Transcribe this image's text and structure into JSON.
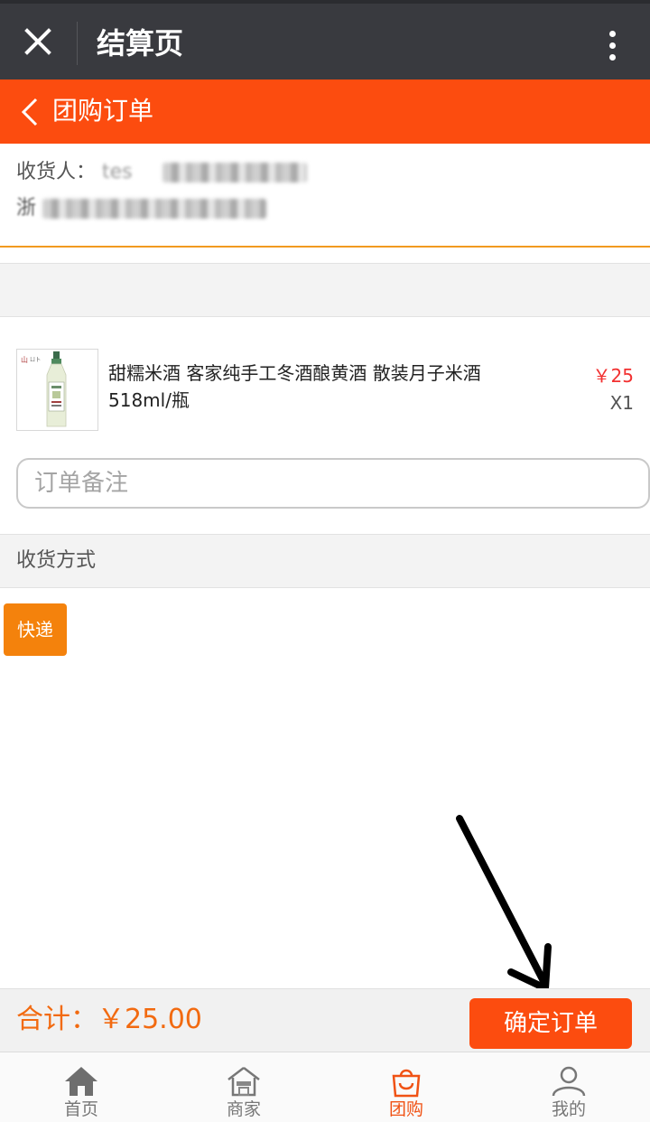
{
  "wechat_bar": {
    "title": "结算页",
    "close_icon": "close-icon",
    "more_icon": "more-vertical-icon"
  },
  "nav": {
    "title": "团购订单",
    "back_icon": "chevron-left-icon"
  },
  "address": {
    "recipient_label": "收货人：",
    "recipient_name_visible": "tes",
    "address_prefix": "浙"
  },
  "product": {
    "name": "甜糯米酒 客家纯手工冬酒酿黄酒 散装月子米酒518ml/瓶",
    "price": "￥25",
    "quantity": "X1",
    "image": "rice-wine-bottle"
  },
  "remark": {
    "placeholder": "订单备注"
  },
  "shipping": {
    "title": "收货方式",
    "option": "快递"
  },
  "footer": {
    "total_label": "合计：",
    "total_value": "￥25.00",
    "confirm_label": "确定订单"
  },
  "tabs": [
    {
      "label": "首页",
      "icon": "home-icon"
    },
    {
      "label": "商家",
      "icon": "store-icon"
    },
    {
      "label": "团购",
      "icon": "shopping-bag-icon",
      "active": true
    },
    {
      "label": "我的",
      "icon": "user-icon"
    }
  ],
  "colors": {
    "wechat_bar": "#393a3f",
    "accent": "#fc4c0f",
    "shipping_button": "#f4820c",
    "price": "#f23030",
    "total": "#f26a10"
  }
}
